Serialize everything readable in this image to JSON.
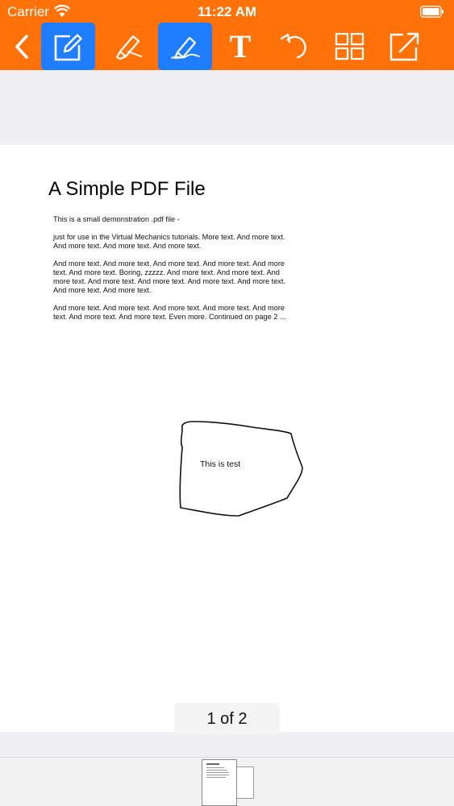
{
  "status_bar": {
    "carrier": "Carrier",
    "time": "11:22 AM"
  },
  "toolbar": {
    "items": [
      {
        "icon": "back-chevron-icon"
      },
      {
        "icon": "edit-pencil-icon",
        "active": true
      },
      {
        "icon": "highlighter-icon"
      },
      {
        "icon": "pen-icon",
        "active": true
      },
      {
        "icon": "text-tool-icon",
        "label": "T"
      },
      {
        "icon": "undo-icon"
      },
      {
        "icon": "grid-icon"
      },
      {
        "icon": "share-icon"
      }
    ],
    "bar_color": "#ff7209",
    "active_color": "#1f7dff"
  },
  "document": {
    "title": "A Simple PDF File",
    "paragraphs": [
      "This is a small demonstration .pdf file -",
      "just for use in the Virtual Mechanics tutorials. More text. And more text. And more text. And more text. And more text.",
      "And more text. And more text. And more text. And more text. And more text. And more text. Boring, zzzzz. And more text. And more text. And more text. And more text. And more text. And more text. And more text. And more text. And more text.",
      "And more text. And more text. And more text. And more text. And more text. And more text. And more text. Even more. Continued on page 2 ..."
    ],
    "annotation_text": "This is test"
  },
  "pager": {
    "label": "1 of 2"
  }
}
